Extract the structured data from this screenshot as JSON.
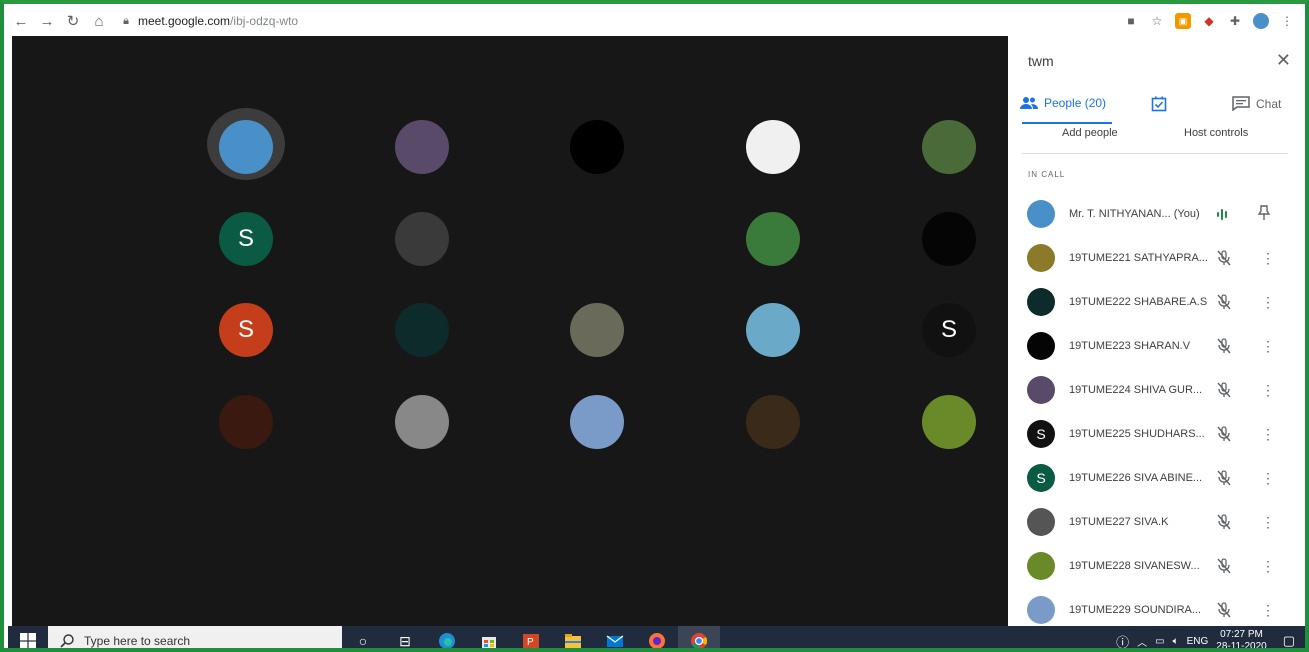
{
  "browser": {
    "url_host": "meet.google.com",
    "url_path": "/ibj-odzq-wto"
  },
  "panel": {
    "title": "twm",
    "tab_people": "People (20)",
    "tab_chat": "Chat",
    "add_people": "Add people",
    "host_controls": "Host controls",
    "section_label": "IN CALL",
    "participants": [
      {
        "name": "Mr. T. NITHYANAN...  (You)",
        "avatar_color": "#4a90c8",
        "you": true
      },
      {
        "name": "19TUME221 SATHYAPRA...",
        "avatar_color": "#8a7a2a"
      },
      {
        "name": "19TUME222 SHABARE.A.S",
        "avatar_color": "#0d2b2b"
      },
      {
        "name": "19TUME223 SHARAN.V",
        "avatar_color": "#050505"
      },
      {
        "name": "19TUME224 SHIVA GUR...",
        "avatar_color": "#5a4a6a"
      },
      {
        "name": "19TUME225 SHUDHARS...",
        "avatar_color": "#111111",
        "letter": "S"
      },
      {
        "name": "19TUME226 SIVA ABINE...",
        "avatar_color": "#0b5a44",
        "letter": "S"
      },
      {
        "name": "19TUME227 SIVA.K",
        "avatar_color": "#555555"
      },
      {
        "name": "19TUME228 SIVANESW...",
        "avatar_color": "#6a8a2a"
      },
      {
        "name": "19TUME229 SOUNDIRA...",
        "avatar_color": "#7a9ac8"
      }
    ]
  },
  "stage": {
    "tiles": [
      {
        "color": "#4a90c8"
      },
      {
        "color": "#5a4a6a"
      },
      {
        "color": "#000000"
      },
      {
        "color": "#f0f0f0"
      },
      {
        "color": "#4a6a3a"
      },
      {
        "color": "#0b5a44",
        "letter": "S"
      },
      {
        "color": "#3a3a3a"
      },
      {
        "color": "#171717"
      },
      {
        "color": "#3a7a3a"
      },
      {
        "color": "#050505"
      },
      {
        "color": "#c43e1c",
        "letter": "S"
      },
      {
        "color": "#0d2b2b"
      },
      {
        "color": "#6a6a5a"
      },
      {
        "color": "#6aaac8"
      },
      {
        "color": "#111111",
        "letter": "S"
      },
      {
        "color": "#3a1a10"
      },
      {
        "color": "#888888"
      },
      {
        "color": "#7a9ac8"
      },
      {
        "color": "#3a2a1a"
      },
      {
        "color": "#6a8a2a"
      }
    ]
  },
  "taskbar": {
    "search_placeholder": "Type here to search",
    "lang": "ENG",
    "time": "07:27 PM",
    "date": "28-11-2020"
  }
}
